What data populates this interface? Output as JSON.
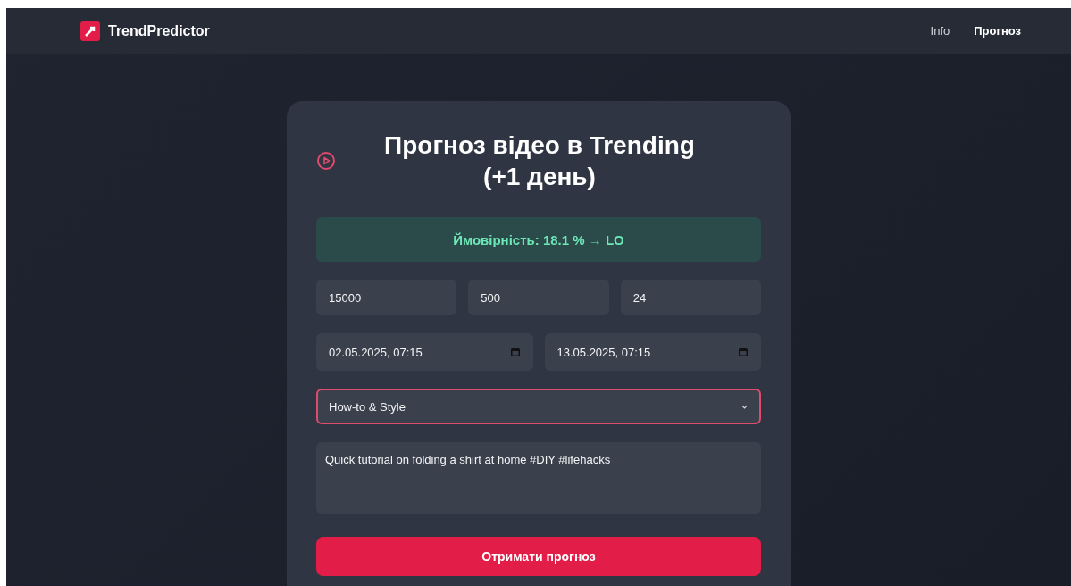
{
  "navbar": {
    "brand": "TrendPredictor",
    "links": [
      {
        "label": "Info",
        "selected": false
      },
      {
        "label": "Прогноз",
        "selected": true
      }
    ]
  },
  "card": {
    "title": "Прогноз відео в Trending (+1 день)",
    "result": "Ймовірність: 18.1 % → LO",
    "number_fields": [
      {
        "value": "15000"
      },
      {
        "value": "500"
      },
      {
        "value": "24"
      }
    ],
    "date_fields": [
      {
        "value": "02.05.2025, 07:15"
      },
      {
        "value": "13.05.2025, 07:15"
      }
    ],
    "category": {
      "value": "How-to & Style",
      "focused": true
    },
    "description": {
      "value": "Quick tutorial on folding a shirt at home #DIY #lifehacks"
    },
    "submit": "Отримати прогноз"
  }
}
